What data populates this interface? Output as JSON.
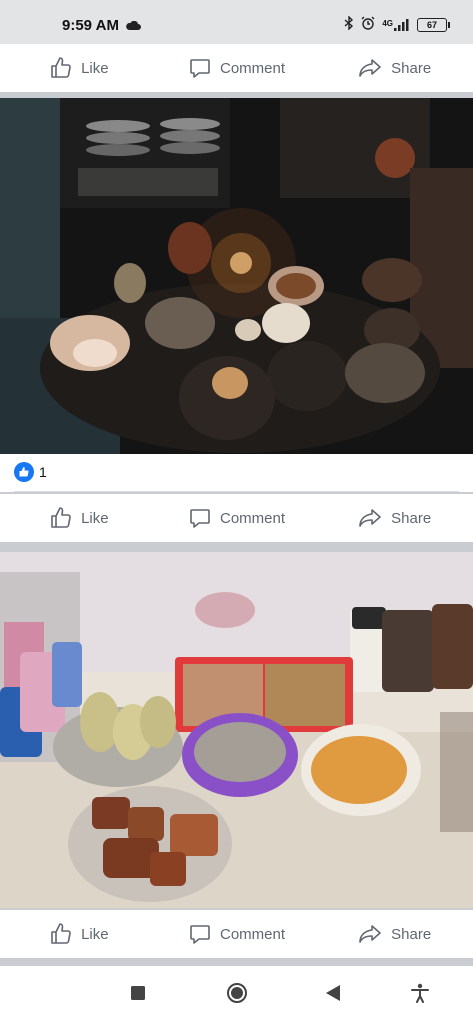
{
  "status_bar": {
    "time": "9:59 AM",
    "battery": "67",
    "network": "4G"
  },
  "post1": {
    "actions": {
      "like": "Like",
      "comment": "Comment",
      "share": "Share"
    }
  },
  "post2": {
    "reaction_count": "1",
    "actions": {
      "like": "Like",
      "comment": "Comment",
      "share": "Share"
    }
  },
  "post3": {
    "actions": {
      "like": "Like",
      "comment": "Comment",
      "share": "Share"
    }
  },
  "colors": {
    "facebook_blue": "#1877f2",
    "action_gray": "#606770"
  },
  "icons": [
    "like-icon",
    "comment-icon",
    "share-icon",
    "stop-square-icon",
    "home-circle-icon",
    "back-triangle-icon",
    "accessibility-icon"
  ]
}
